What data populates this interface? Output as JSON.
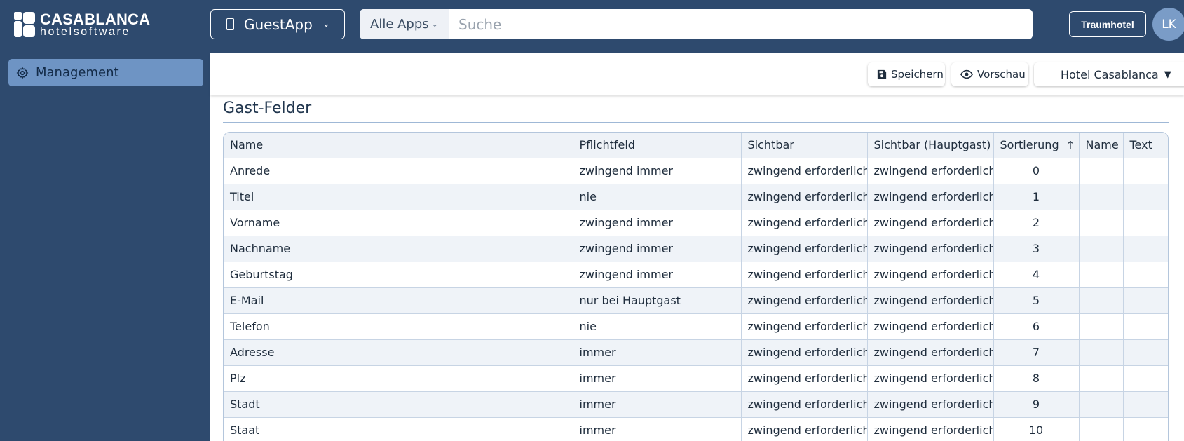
{
  "brand": {
    "line1": "CASABLANCA",
    "line2": "hotelsoftware"
  },
  "app_switch": {
    "label": "GuestApp",
    "icon": "smartphone-icon"
  },
  "search": {
    "scope": "Alle Apps",
    "placeholder": "Suche",
    "value": ""
  },
  "hotel_button": "Traumhotel",
  "user": {
    "initials": "LK"
  },
  "sidebar": {
    "items": [
      {
        "label": "Management",
        "icon": "gear-icon",
        "active": true
      }
    ]
  },
  "toolbar": {
    "save_label": "Speichern",
    "preview_label": "Vorschau",
    "hotel_select": "Hotel Casablanca"
  },
  "section_title": "Gast-Felder",
  "table": {
    "columns": [
      "Name",
      "Pflichtfeld",
      "Sichtbar",
      "Sichtbar (Hauptgast)",
      "Sortierung",
      "Name",
      "Text"
    ],
    "sort_column": "Sortierung",
    "sort_direction": "ascending",
    "rows": [
      [
        "Anrede",
        "zwingend immer",
        "zwingend erforderlich",
        "zwingend erforderlich",
        "0",
        "",
        ""
      ],
      [
        "Titel",
        "nie",
        "zwingend erforderlich",
        "zwingend erforderlich",
        "1",
        "",
        ""
      ],
      [
        "Vorname",
        "zwingend immer",
        "zwingend erforderlich",
        "zwingend erforderlich",
        "2",
        "",
        ""
      ],
      [
        "Nachname",
        "zwingend immer",
        "zwingend erforderlich",
        "zwingend erforderlich",
        "3",
        "",
        ""
      ],
      [
        "Geburtstag",
        "zwingend immer",
        "zwingend erforderlich",
        "zwingend erforderlich",
        "4",
        "",
        ""
      ],
      [
        "E-Mail",
        "nur bei Hauptgast",
        "zwingend erforderlich",
        "zwingend erforderlich",
        "5",
        "",
        ""
      ],
      [
        "Telefon",
        "nie",
        "zwingend erforderlich",
        "zwingend erforderlich",
        "6",
        "",
        ""
      ],
      [
        "Adresse",
        "immer",
        "zwingend erforderlich",
        "zwingend erforderlich",
        "7",
        "",
        ""
      ],
      [
        "Plz",
        "immer",
        "zwingend erforderlich",
        "zwingend erforderlich",
        "8",
        "",
        ""
      ],
      [
        "Stadt",
        "immer",
        "zwingend erforderlich",
        "zwingend erforderlich",
        "9",
        "",
        ""
      ],
      [
        "Staat",
        "immer",
        "zwingend erforderlich",
        "zwingend erforderlich",
        "10",
        "",
        ""
      ]
    ]
  },
  "colors": {
    "header_bg": "#2e4a6e",
    "sidebar_active": "#6e94c4",
    "avatar_bg": "#7a9cc7",
    "row_alt": "#eff3f8"
  }
}
